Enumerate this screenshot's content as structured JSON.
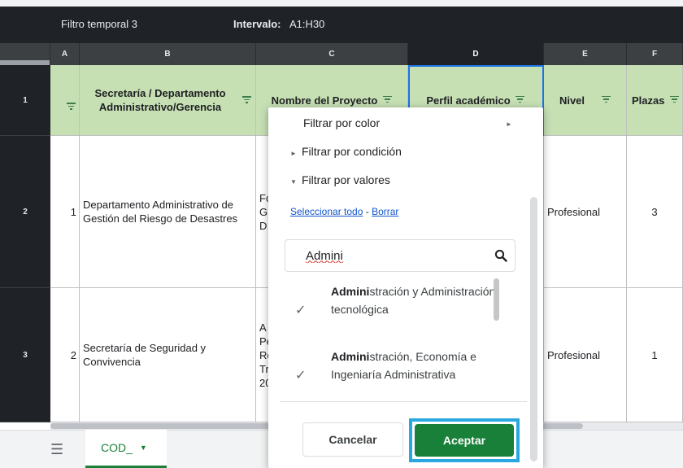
{
  "filter_bar": {
    "name": "Filtro temporal 3",
    "range_label": "Intervalo:",
    "range_value": "A1:H30"
  },
  "columns": [
    "A",
    "B",
    "C",
    "D",
    "E",
    "F"
  ],
  "rows": [
    "1",
    "2",
    "3"
  ],
  "header_row": {
    "b": "Secretaría / Departamento Administrativo/Gerencia",
    "c": "Nombre del Proyecto",
    "d": "Perfil académico",
    "e": "Nivel",
    "f": "Plazas"
  },
  "data_rows": [
    {
      "a": "1",
      "b": "Departamento Administrativo de Gestión del Riesgo de Desastres",
      "c": "Fo\nG\nD",
      "e": "Profesional",
      "f": "3"
    },
    {
      "a": "2",
      "b": "Secretaría de Seguridad y Convivencia",
      "c": "A\nPe\nRe\nTr\n20",
      "e": "Profesional",
      "f": "1"
    }
  ],
  "popup": {
    "filter_by_color": "Filtrar por color",
    "filter_by_condition": "Filtrar por condición",
    "filter_by_values": "Filtrar por valores",
    "select_all": "Seleccionar todo",
    "link_sep": "-",
    "clear": "Borrar",
    "search_value": "Admini",
    "items": [
      {
        "match": "Admini",
        "rest": "stración y Administración tecnológica",
        "checked": "✓"
      },
      {
        "match": "Admini",
        "rest": "stración, Economía e Ingeniaría Administrativa",
        "checked": "✓"
      }
    ],
    "cancel_label": "Cancelar",
    "ok_label": "Aceptar"
  },
  "footer": {
    "menu_icon": "☰",
    "sheet_name": "COD_",
    "sheet_caret": "▼"
  },
  "colors": {
    "header_green": "#c6e0b4",
    "dark_bg": "#1f2226",
    "ok_green": "#188038",
    "highlight": "#29a8e0"
  }
}
